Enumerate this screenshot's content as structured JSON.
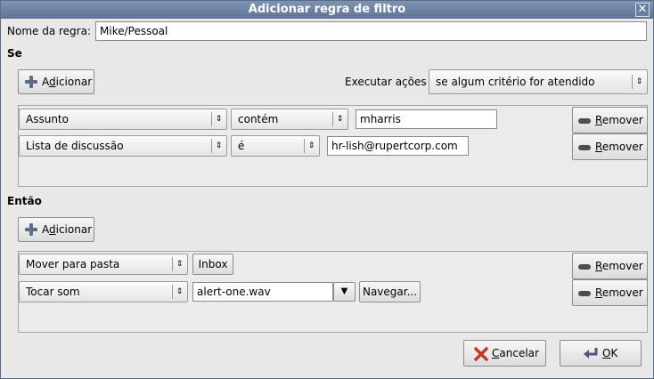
{
  "window": {
    "title": "Adicionar regra de filtro",
    "close_glyph": "✕"
  },
  "rule_name": {
    "label": "Nome da regra:",
    "value": "Mike/Pessoal"
  },
  "if_section": {
    "heading": "Se",
    "add_button": {
      "pre": "A",
      "accel": "d",
      "post": "icionar"
    },
    "execute_label": "Executar ações",
    "execute_value": "se algum critério for atendido",
    "rows": [
      {
        "field": "Assunto",
        "operator": "contém",
        "value": "mharris",
        "remove": {
          "accel": "R",
          "post": "emover"
        }
      },
      {
        "field": "Lista de discussão",
        "operator": "é",
        "value": "hr-lish@rupertcorp.com",
        "remove": {
          "accel": "R",
          "post": "emover"
        }
      }
    ]
  },
  "then_section": {
    "heading": "Então",
    "add_button": {
      "pre": "A",
      "accel": "d",
      "post": "icionar"
    },
    "rows": [
      {
        "action": "Mover para pasta",
        "folder_button": "Inbox",
        "remove": {
          "accel": "R",
          "post": "emover"
        }
      },
      {
        "action": "Tocar som",
        "sound_value": "alert-one.wav",
        "browse_label": "Navegar...",
        "remove": {
          "accel": "R",
          "post": "emover"
        }
      }
    ]
  },
  "footer": {
    "cancel": {
      "accel": "C",
      "post": "ancelar"
    },
    "ok": {
      "accel": "O",
      "post": "K"
    }
  },
  "colors": {
    "title_bar": "#6a7fa3",
    "cancel_icon": "#c0392b",
    "add_icon": "#5f6d8a"
  },
  "icons": {
    "add": "plus-icon",
    "remove": "minus-icon",
    "cancel": "x-icon",
    "ok": "enter-icon",
    "spin": "updown-arrows-icon",
    "dropdown": "triangle-down-icon"
  }
}
